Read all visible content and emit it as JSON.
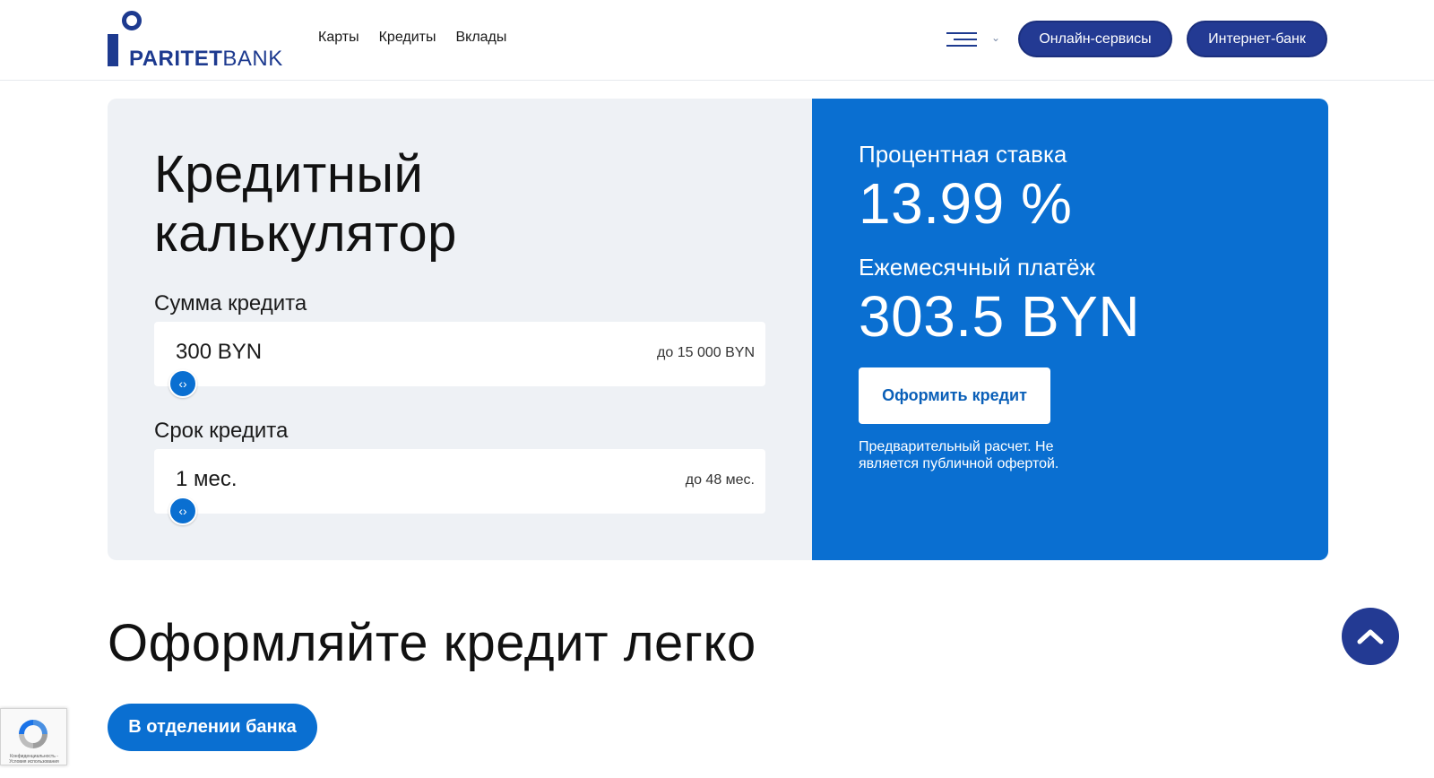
{
  "header": {
    "logo_text_bold": "PARITET",
    "logo_text_thin": "BANK",
    "nav": [
      "Карты",
      "Кредиты",
      "Вклады"
    ],
    "online_services": "Онлайн-сервисы",
    "internet_bank": "Интернет-банк"
  },
  "calculator": {
    "title_line1": "Кредитный",
    "title_line2": "калькулятор",
    "amount": {
      "label": "Сумма кредита",
      "value": "300 BYN",
      "max": "до 15 000 BYN",
      "slider_fraction": 0.0
    },
    "term": {
      "label": "Срок кредита",
      "value": "1 мес.",
      "max": "до 48 мес.",
      "slider_fraction": 0.0
    },
    "rate_label": "Процентная ставка",
    "rate_value": "13.99 %",
    "payment_label": "Ежемесячный платёж",
    "payment_value": "303.5 BYN",
    "apply_button": "Оформить кредит",
    "disclaimer": "Предварительный расчет. Не является публичной офертой."
  },
  "section": {
    "title": "Оформляйте кредит легко",
    "branch_button": "В отделении банка"
  },
  "recaptcha": {
    "text": "Конфиденциальность - Условия использования"
  },
  "colors": {
    "brand_dark": "#233a93",
    "brand_blue": "#0a6fd1",
    "panel_bg": "#eef1f5"
  }
}
